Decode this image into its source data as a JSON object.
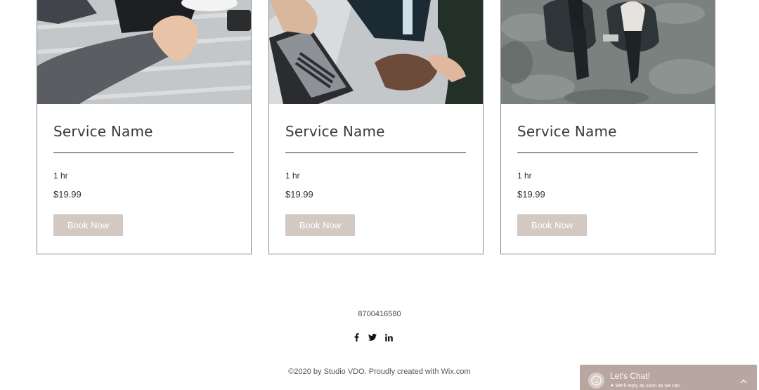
{
  "services": [
    {
      "title": "Service Name",
      "duration": "1 hr",
      "price": "$19.99",
      "button": "Book Now",
      "image": "hands-with-tablet-photo"
    },
    {
      "title": "Service Name",
      "duration": "1 hr",
      "price": "$19.99",
      "button": "Book Now",
      "image": "laptop-meeting-photo"
    },
    {
      "title": "Service Name",
      "duration": "1 hr",
      "price": "$19.99",
      "button": "Book Now",
      "image": "two-people-armchairs-photo"
    }
  ],
  "footer": {
    "phone": "8700416580",
    "social": [
      "facebook-icon",
      "twitter-icon",
      "linkedin-icon"
    ],
    "copyright": "©2020 by Studio VDO. Proudly created with Wix.com"
  },
  "chat": {
    "title": "Let's Chat!",
    "subtitle": "We'll reply as soon as we can"
  },
  "colors": {
    "button": "#d4c8c3",
    "chat": "#b8a7a0",
    "border": "#8a8a8a"
  }
}
